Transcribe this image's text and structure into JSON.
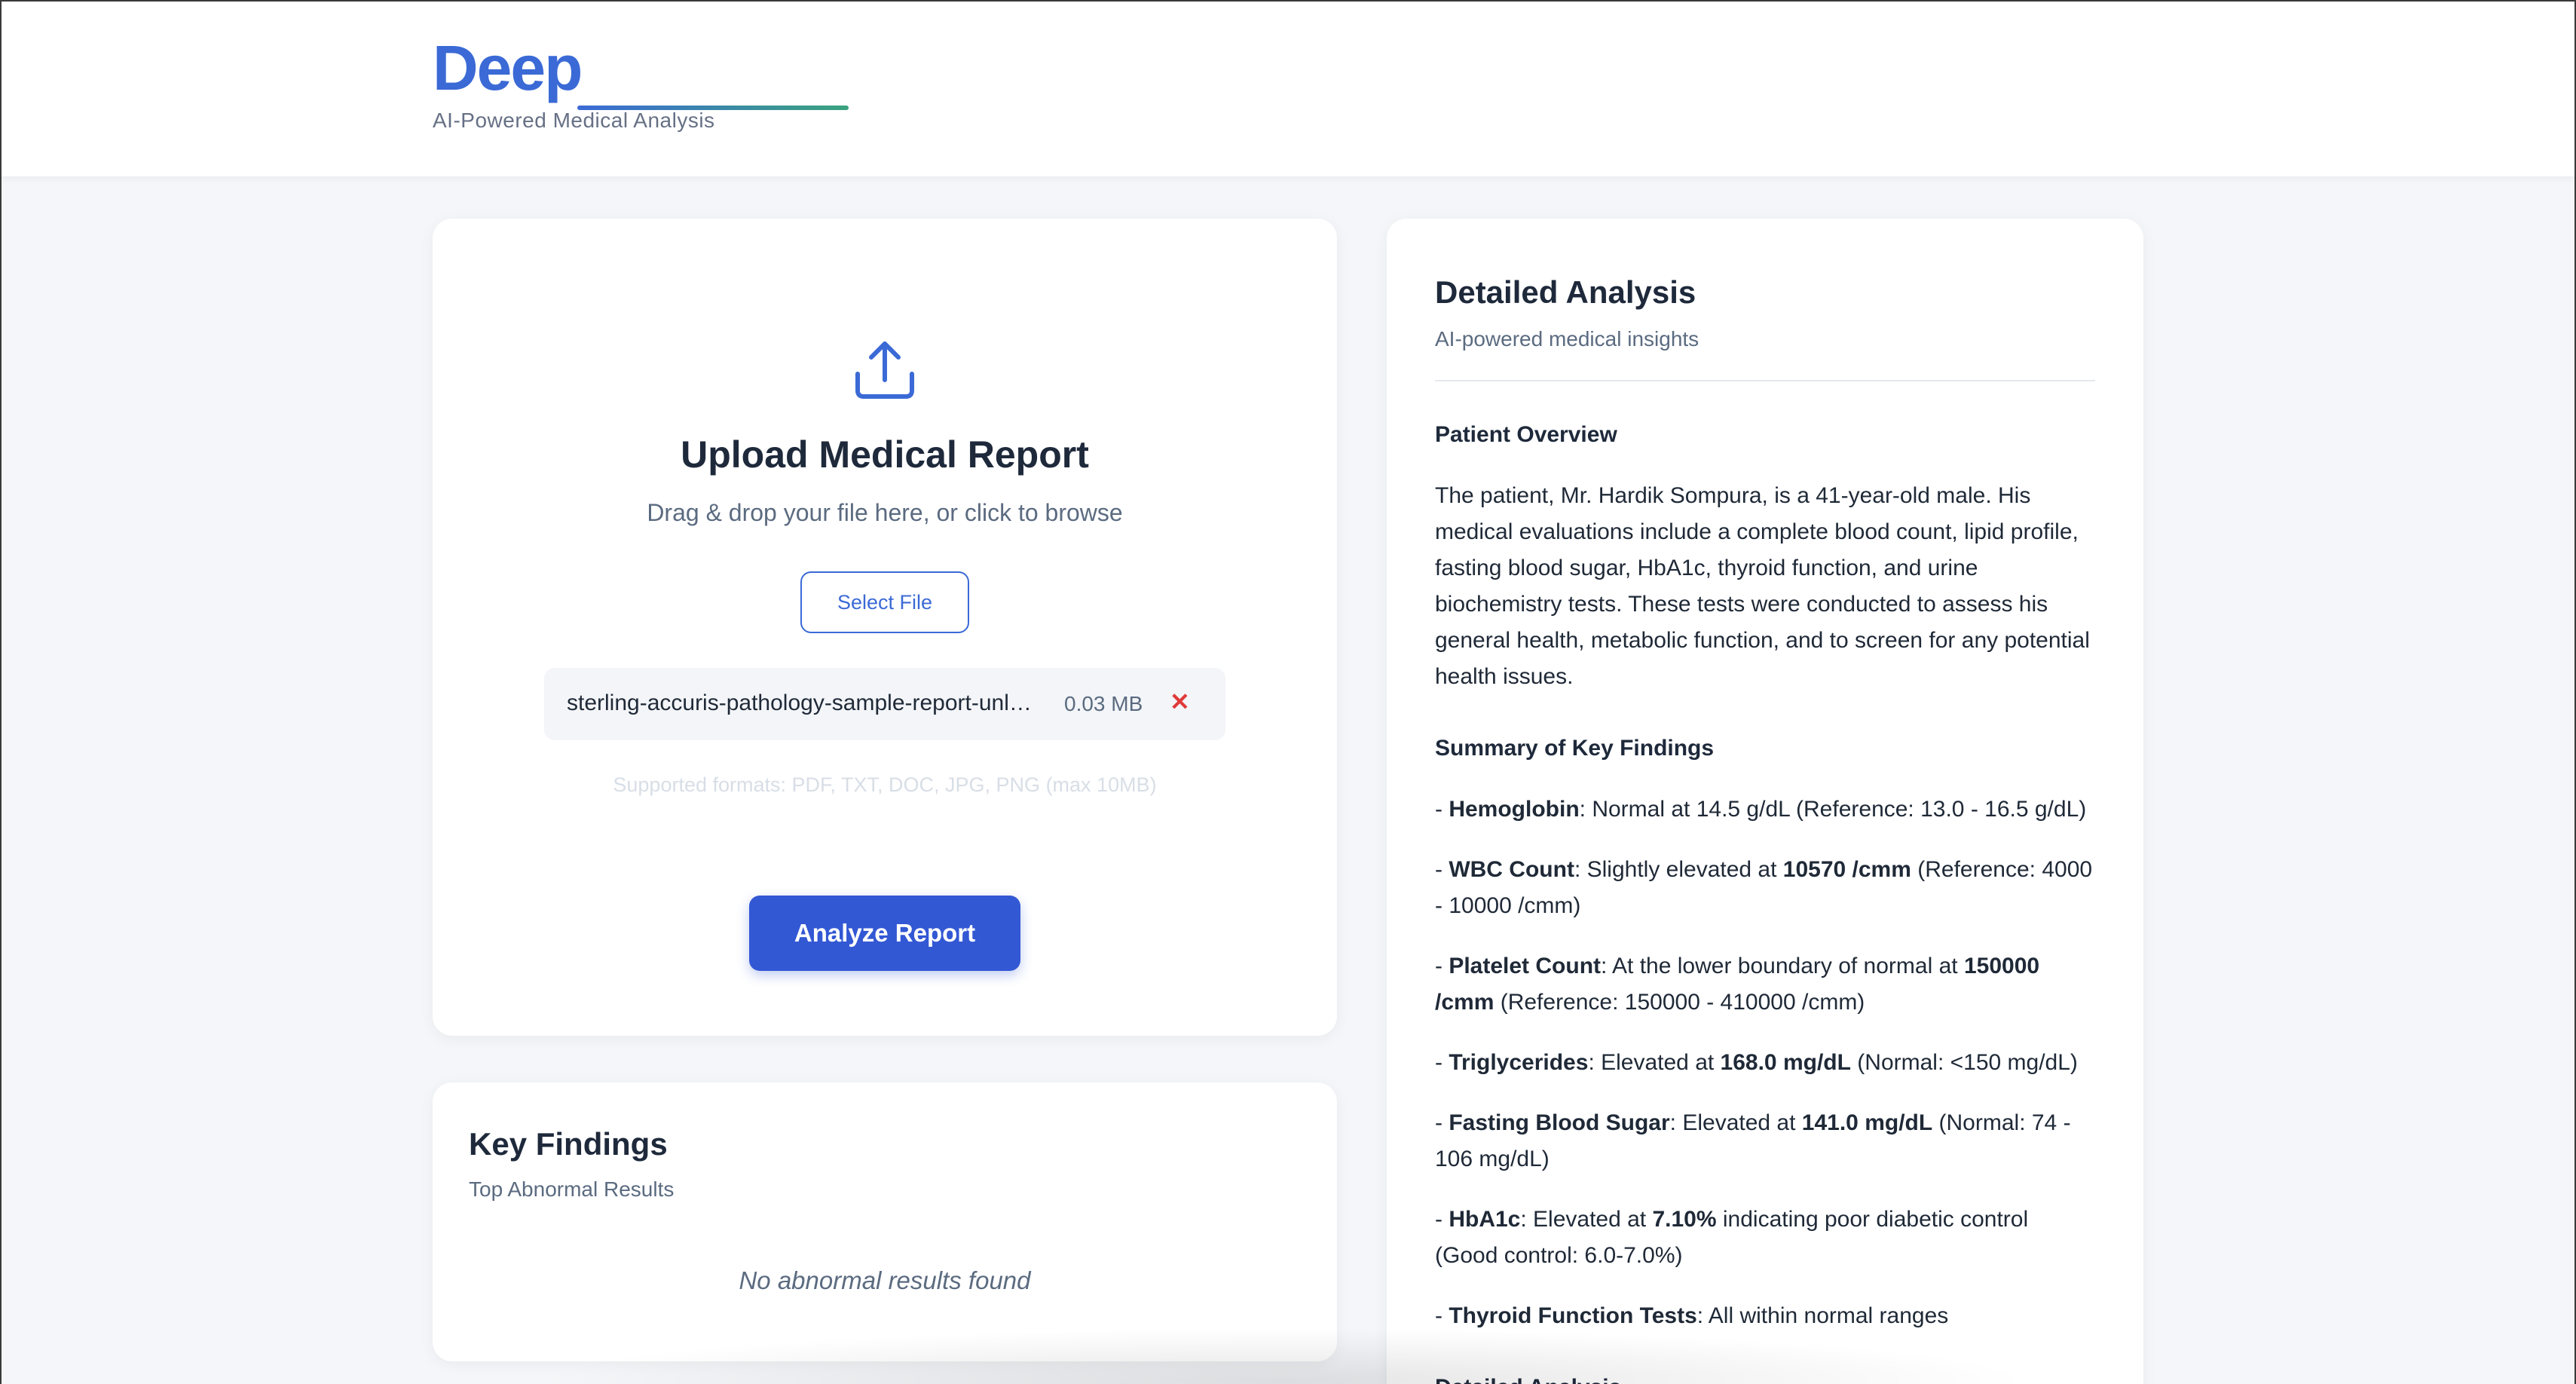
{
  "header": {
    "logo": "Deep",
    "tagline": "AI-Powered Medical Analysis"
  },
  "upload": {
    "icon": "upload-icon",
    "title": "Upload Medical Report",
    "subtitle": "Drag & drop your file here, or click to browse",
    "select_button": "Select File",
    "file": {
      "name": "sterling-accuris-pathology-sample-report-unl…",
      "size": "0.03 MB",
      "remove": "✕"
    },
    "formats": "Supported formats: PDF, TXT, DOC, JPG, PNG (max 10MB)",
    "analyze_button": "Analyze Report"
  },
  "key_findings": {
    "title": "Key Findings",
    "subtitle": "Top Abnormal Results",
    "empty": "No abnormal results found"
  },
  "analysis": {
    "title": "Detailed Analysis",
    "subtitle": "AI-powered medical insights",
    "patient_overview_heading": "Patient Overview",
    "patient_overview_lines": [
      "The patient, Mr. Hardik Sompura, is a 41-year-old male. His",
      "medical evaluations include a complete blood count, lipid profile,",
      "fasting blood sugar, HbA1c, thyroid function, and urine",
      "biochemistry tests. These tests were conducted to assess his",
      "general health, metabolic function, and to screen for any potential",
      "health issues."
    ],
    "summary_heading": "Summary of Key Findings",
    "findings": [
      {
        "prefix": "- ",
        "label": "Hemoglobin",
        "text1": ": Normal at 14.5 g/dL (Reference: 13.0 - 16.5 g/dL)",
        "value": "",
        "text2": ""
      },
      {
        "prefix": "- ",
        "label": "WBC Count",
        "text1": ": Slightly elevated at ",
        "value": "10570 /cmm",
        "text2": " (Reference: 4000 - 10000 /cmm)"
      },
      {
        "prefix": "- ",
        "label": "Platelet Count",
        "text1": ": At the lower boundary of normal at ",
        "value": "150000 /cmm",
        "text2": " (Reference: 150000 - 410000 /cmm)"
      },
      {
        "prefix": "- ",
        "label": "Triglycerides",
        "text1": ": Elevated at ",
        "value": "168.0 mg/dL",
        "text2": " (Normal: <150 mg/dL)"
      },
      {
        "prefix": "- ",
        "label": "Fasting Blood Sugar",
        "text1": ": Elevated at ",
        "value": "141.0 mg/dL",
        "text2": " (Normal: 74 - 106 mg/dL)"
      },
      {
        "prefix": "- ",
        "label": "HbA1c",
        "text1": ": Elevated at ",
        "value": "7.10%",
        "text2": " indicating poor diabetic control (Good control: 6.0-7.0%)"
      },
      {
        "prefix": "- ",
        "label": "Thyroid Function Tests",
        "text1": ": All within normal ranges",
        "value": "",
        "text2": ""
      }
    ],
    "next_heading": "Detailed Analysis"
  },
  "colors": {
    "accent": "#3b6ad6",
    "button": "#3358d4",
    "remove": "#e03a3a",
    "background": "#f4f6f9"
  }
}
